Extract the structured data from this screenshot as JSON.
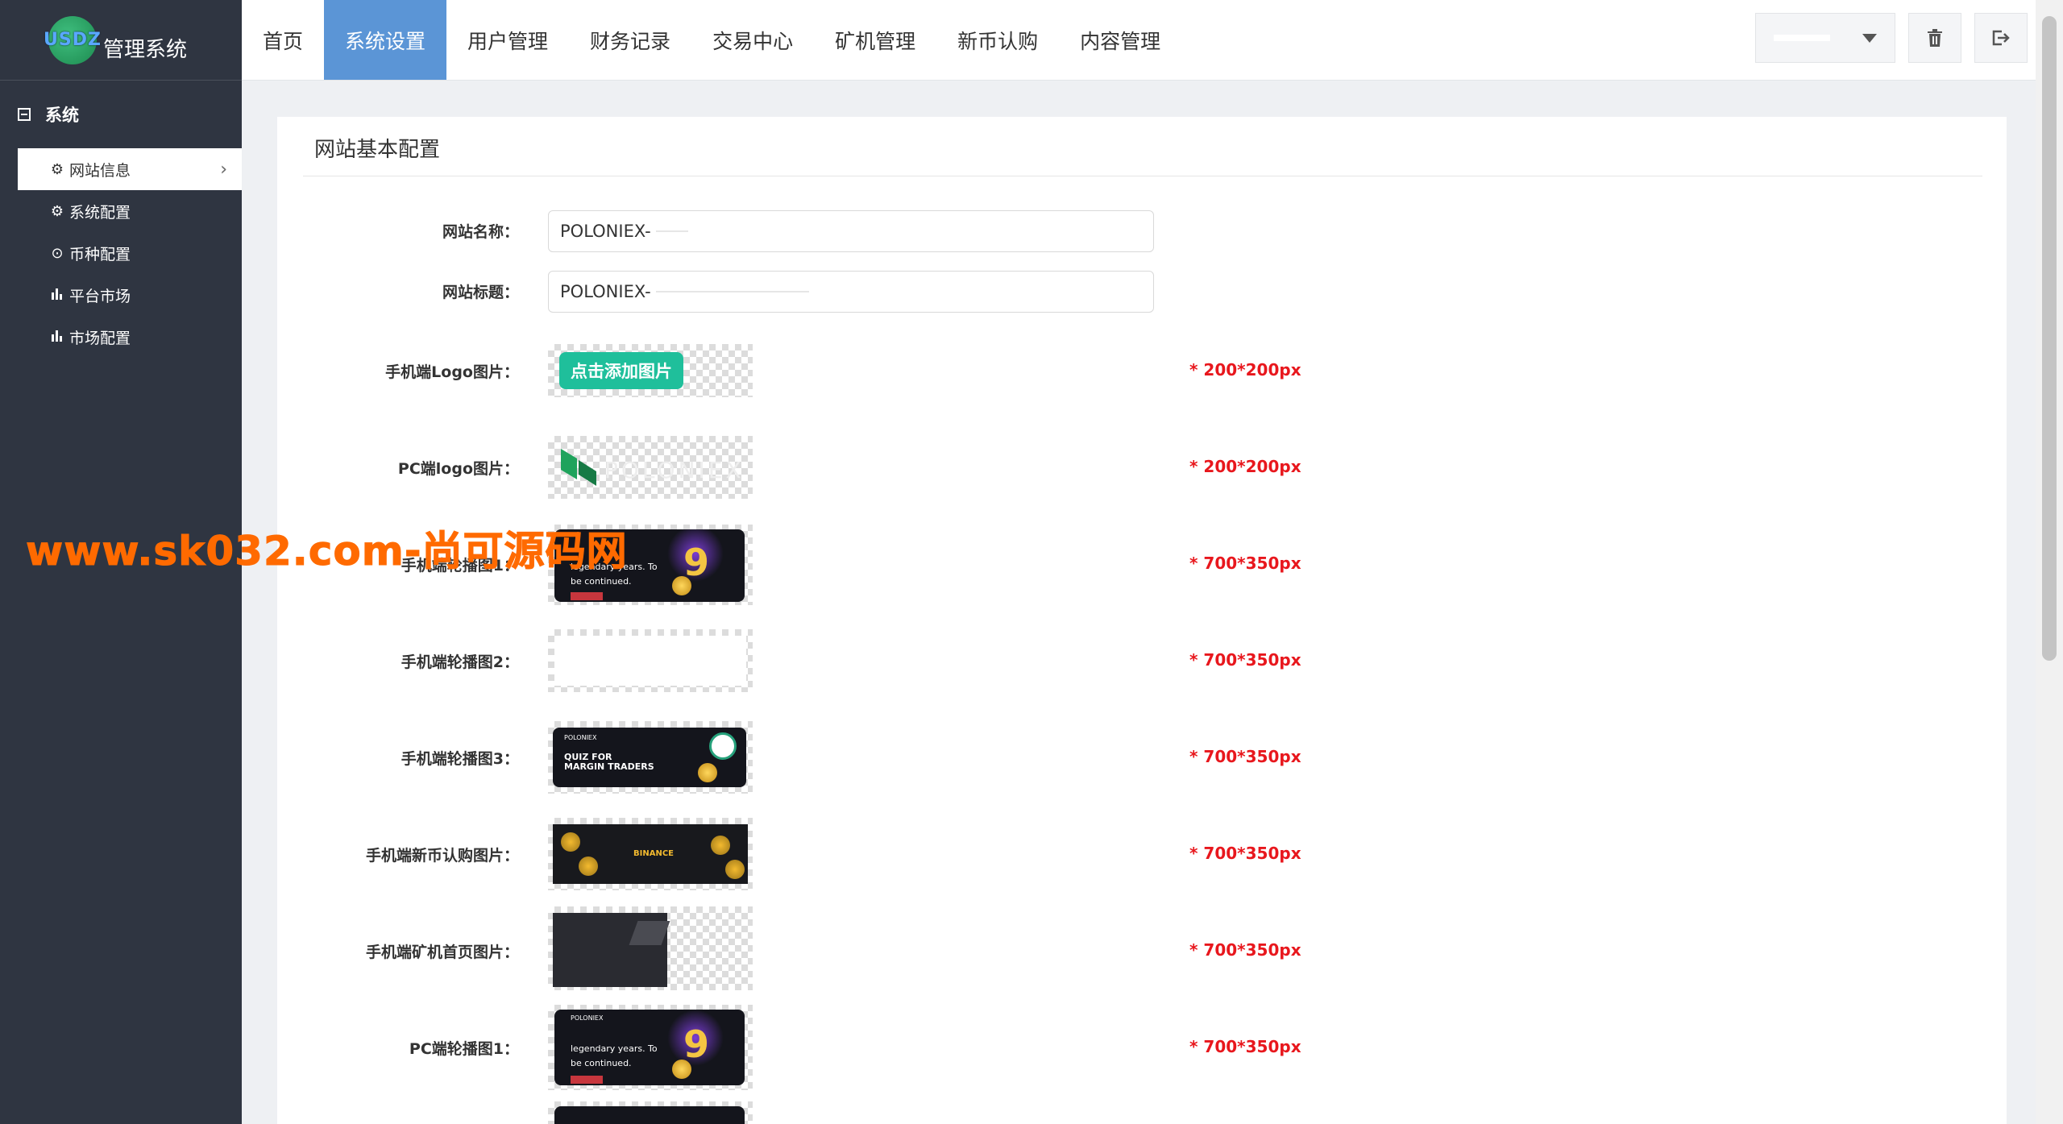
{
  "app": {
    "logo_text": "USDZ",
    "name": "管理系统"
  },
  "top_nav": {
    "tabs": [
      {
        "label": "首页",
        "active": false
      },
      {
        "label": "系统设置",
        "active": true
      },
      {
        "label": "用户管理",
        "active": false
      },
      {
        "label": "财务记录",
        "active": false
      },
      {
        "label": "交易中心",
        "active": false
      },
      {
        "label": "矿机管理",
        "active": false
      },
      {
        "label": "新币认购",
        "active": false
      },
      {
        "label": "内容管理",
        "active": false
      }
    ],
    "icons": {
      "dropdown": "caret-down-icon",
      "delete": "trash-icon",
      "logout": "logout-icon"
    }
  },
  "sidebar": {
    "section": "系统",
    "items": [
      {
        "label": "网站信息",
        "icon": "gear-icon",
        "active": true
      },
      {
        "label": "系统配置",
        "icon": "gear-icon",
        "active": false
      },
      {
        "label": "币种配置",
        "icon": "target-icon",
        "active": false
      },
      {
        "label": "平台市场",
        "icon": "bar-chart-icon",
        "active": false
      },
      {
        "label": "市场配置",
        "icon": "bar-chart-icon",
        "active": false
      }
    ]
  },
  "panel": {
    "title": "网站基本配置",
    "fields": [
      {
        "label": "网站名称：",
        "value": "POLONIEX-"
      },
      {
        "label": "网站标题：",
        "value": "POLONIEX-"
      }
    ],
    "images": [
      {
        "label": "手机端Logo图片：",
        "hint": "* 200*200px",
        "add_label": "点击添加图片"
      },
      {
        "label": "PC端logo图片：",
        "hint": "* 200*200px",
        "brand": "POLONIEX"
      },
      {
        "label": "手机端轮播图1：",
        "hint": "* 700*350px",
        "text_a": "legendary years. To",
        "text_b": "be continued.",
        "badge": "9"
      },
      {
        "label": "手机端轮播图2：",
        "hint": "* 700*350px"
      },
      {
        "label": "手机端轮播图3：",
        "hint": "* 700*350px",
        "brand": "POLONIEX",
        "text_a": "QUIZ FOR",
        "text_b": "MARGIN TRADERS"
      },
      {
        "label": "手机端新币认购图片：",
        "hint": "* 700*350px",
        "brand": "BINANCE"
      },
      {
        "label": "手机端矿机首页图片：",
        "hint": "* 700*350px"
      },
      {
        "label": "PC端轮播图1：",
        "hint": "* 700*350px",
        "brand": "POLONIEX",
        "text_a": "legendary years. To",
        "text_b": "be continued.",
        "badge": "9"
      }
    ]
  },
  "watermark": "www.sk032.com-尚可源码网",
  "colors": {
    "sidebar_bg": "#2f3541",
    "active_tab": "#5b95d6",
    "hint": "#e8171d",
    "add_button": "#1fbf9b"
  }
}
